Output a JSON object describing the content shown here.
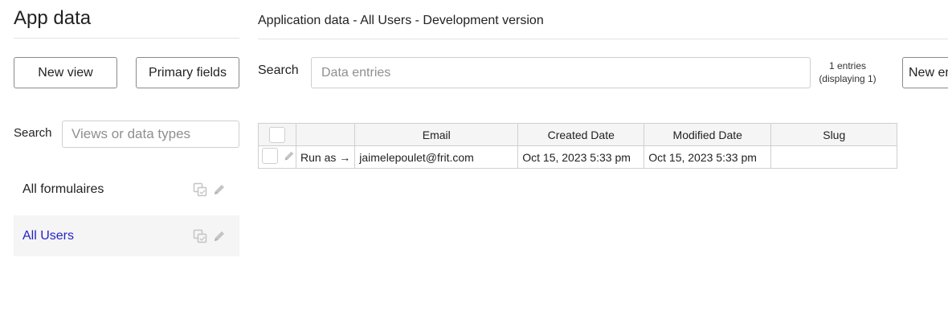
{
  "left": {
    "title": "App data",
    "new_view_label": "New view",
    "primary_fields_label": "Primary fields",
    "search_label": "Search",
    "search_placeholder": "Views or data types",
    "types": [
      {
        "label": "All formulaires",
        "active": false
      },
      {
        "label": "All Users",
        "active": true
      }
    ]
  },
  "main": {
    "title": "Application data - All Users - Development version",
    "search_label": "Search",
    "search_placeholder": "Data entries",
    "entries_line1": "1 entries",
    "entries_line2": "(displaying 1)",
    "new_entry_label": "New entry",
    "table": {
      "headers": [
        "Email",
        "Created Date",
        "Modified Date",
        "Slug"
      ],
      "rows": [
        {
          "run_as": "Run as →",
          "email": "jaimelepoulet@frit.com",
          "created": "Oct 15, 2023 5:33 pm",
          "modified": "Oct 15, 2023 5:33 pm",
          "slug": ""
        }
      ]
    }
  },
  "colors": {
    "active_link": "#2424c8",
    "active_row_bg": "#f5f5f5",
    "border": "#cfcfcf",
    "icon": "#c4c4c4"
  }
}
